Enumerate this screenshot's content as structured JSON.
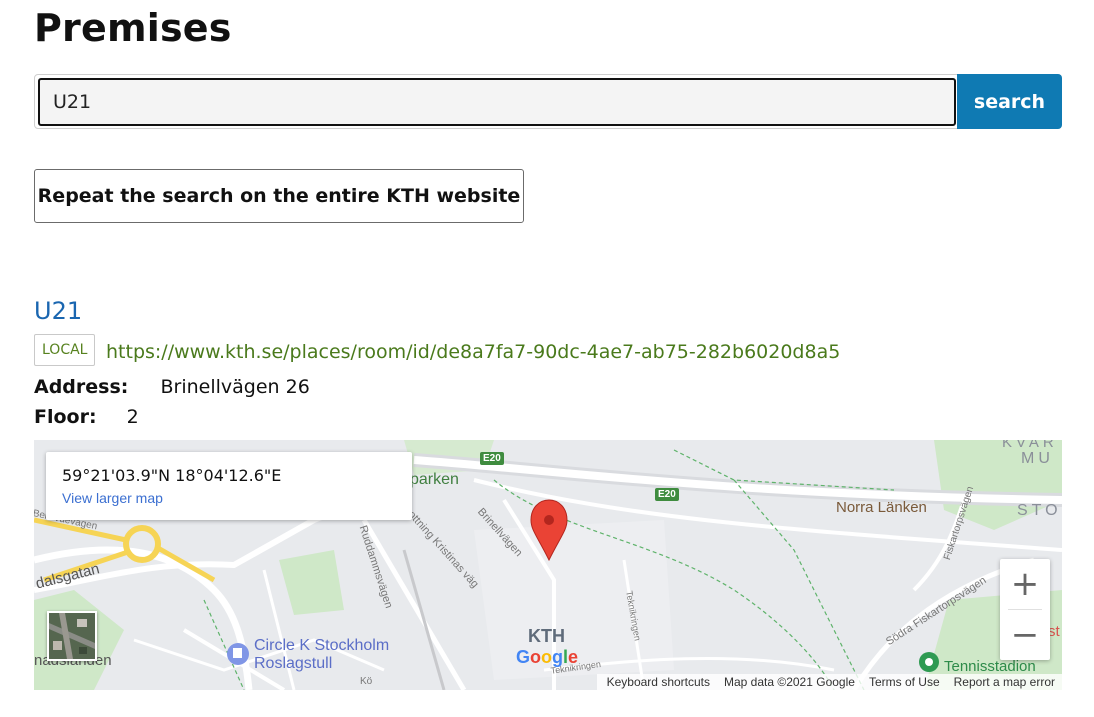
{
  "page": {
    "title": "Premises"
  },
  "search": {
    "value": "U21",
    "button_label": "search"
  },
  "repeat_button": {
    "label": "Repeat the search on the entire KTH website"
  },
  "result": {
    "title": "U21",
    "badge": "LOCAL",
    "url": "https://www.kth.se/places/room/id/de8a7fa7-90dc-4ae7-ab75-282b6020d8a5",
    "address_label": "Address:",
    "address_value": "Brinellvägen 26",
    "floor_label": "Floor:",
    "floor_value": "2"
  },
  "map": {
    "coords": "59°21'03.9\"N 18°04'12.6\"E",
    "view_larger": "View larger map",
    "zoom_in": "+",
    "zoom_out": "−",
    "labels": {
      "kvar": "KVAR",
      "mu": "MU",
      "sto": "STO",
      "norra_lanken": "Norra Länken",
      "parken": "parken",
      "e20a": "E20",
      "e20b": "E20",
      "brinellvagen": "Brinellvägen",
      "drottning": "rottning Kristinas väg",
      "ruddammsvagen": "Ruddammsvägen",
      "bellevuevagen": "Bellevuevägen",
      "dalsgatan": "dalsgatan",
      "circle_k_line1": "Circle K Stockholm",
      "circle_k_line2": "Roslagstull",
      "kth": "KTH",
      "teknikringen_v": "Teknikringen",
      "teknikringen_h": "Teknikringen",
      "sodra_fiskartorpsvagen": "Södra Fiskartorpsvägen",
      "fiskartorp_top": "Fiskartorpsvägen",
      "tennisstadion": "Tennisstadion",
      "landen": "nadslanden",
      "ko": "Kö",
      "st": "st"
    },
    "attribution": {
      "keyboard": "Keyboard shortcuts",
      "mapdata": "Map data ©2021 Google",
      "terms": "Terms of Use",
      "report": "Report a map error"
    },
    "google": [
      "G",
      "o",
      "o",
      "g",
      "l",
      "e"
    ],
    "colors": {
      "pin": "#ea4335",
      "park": "#c8e6c0",
      "road": "#ffffff",
      "land": "#e8eaed",
      "accent": "#0f7ab3"
    }
  }
}
